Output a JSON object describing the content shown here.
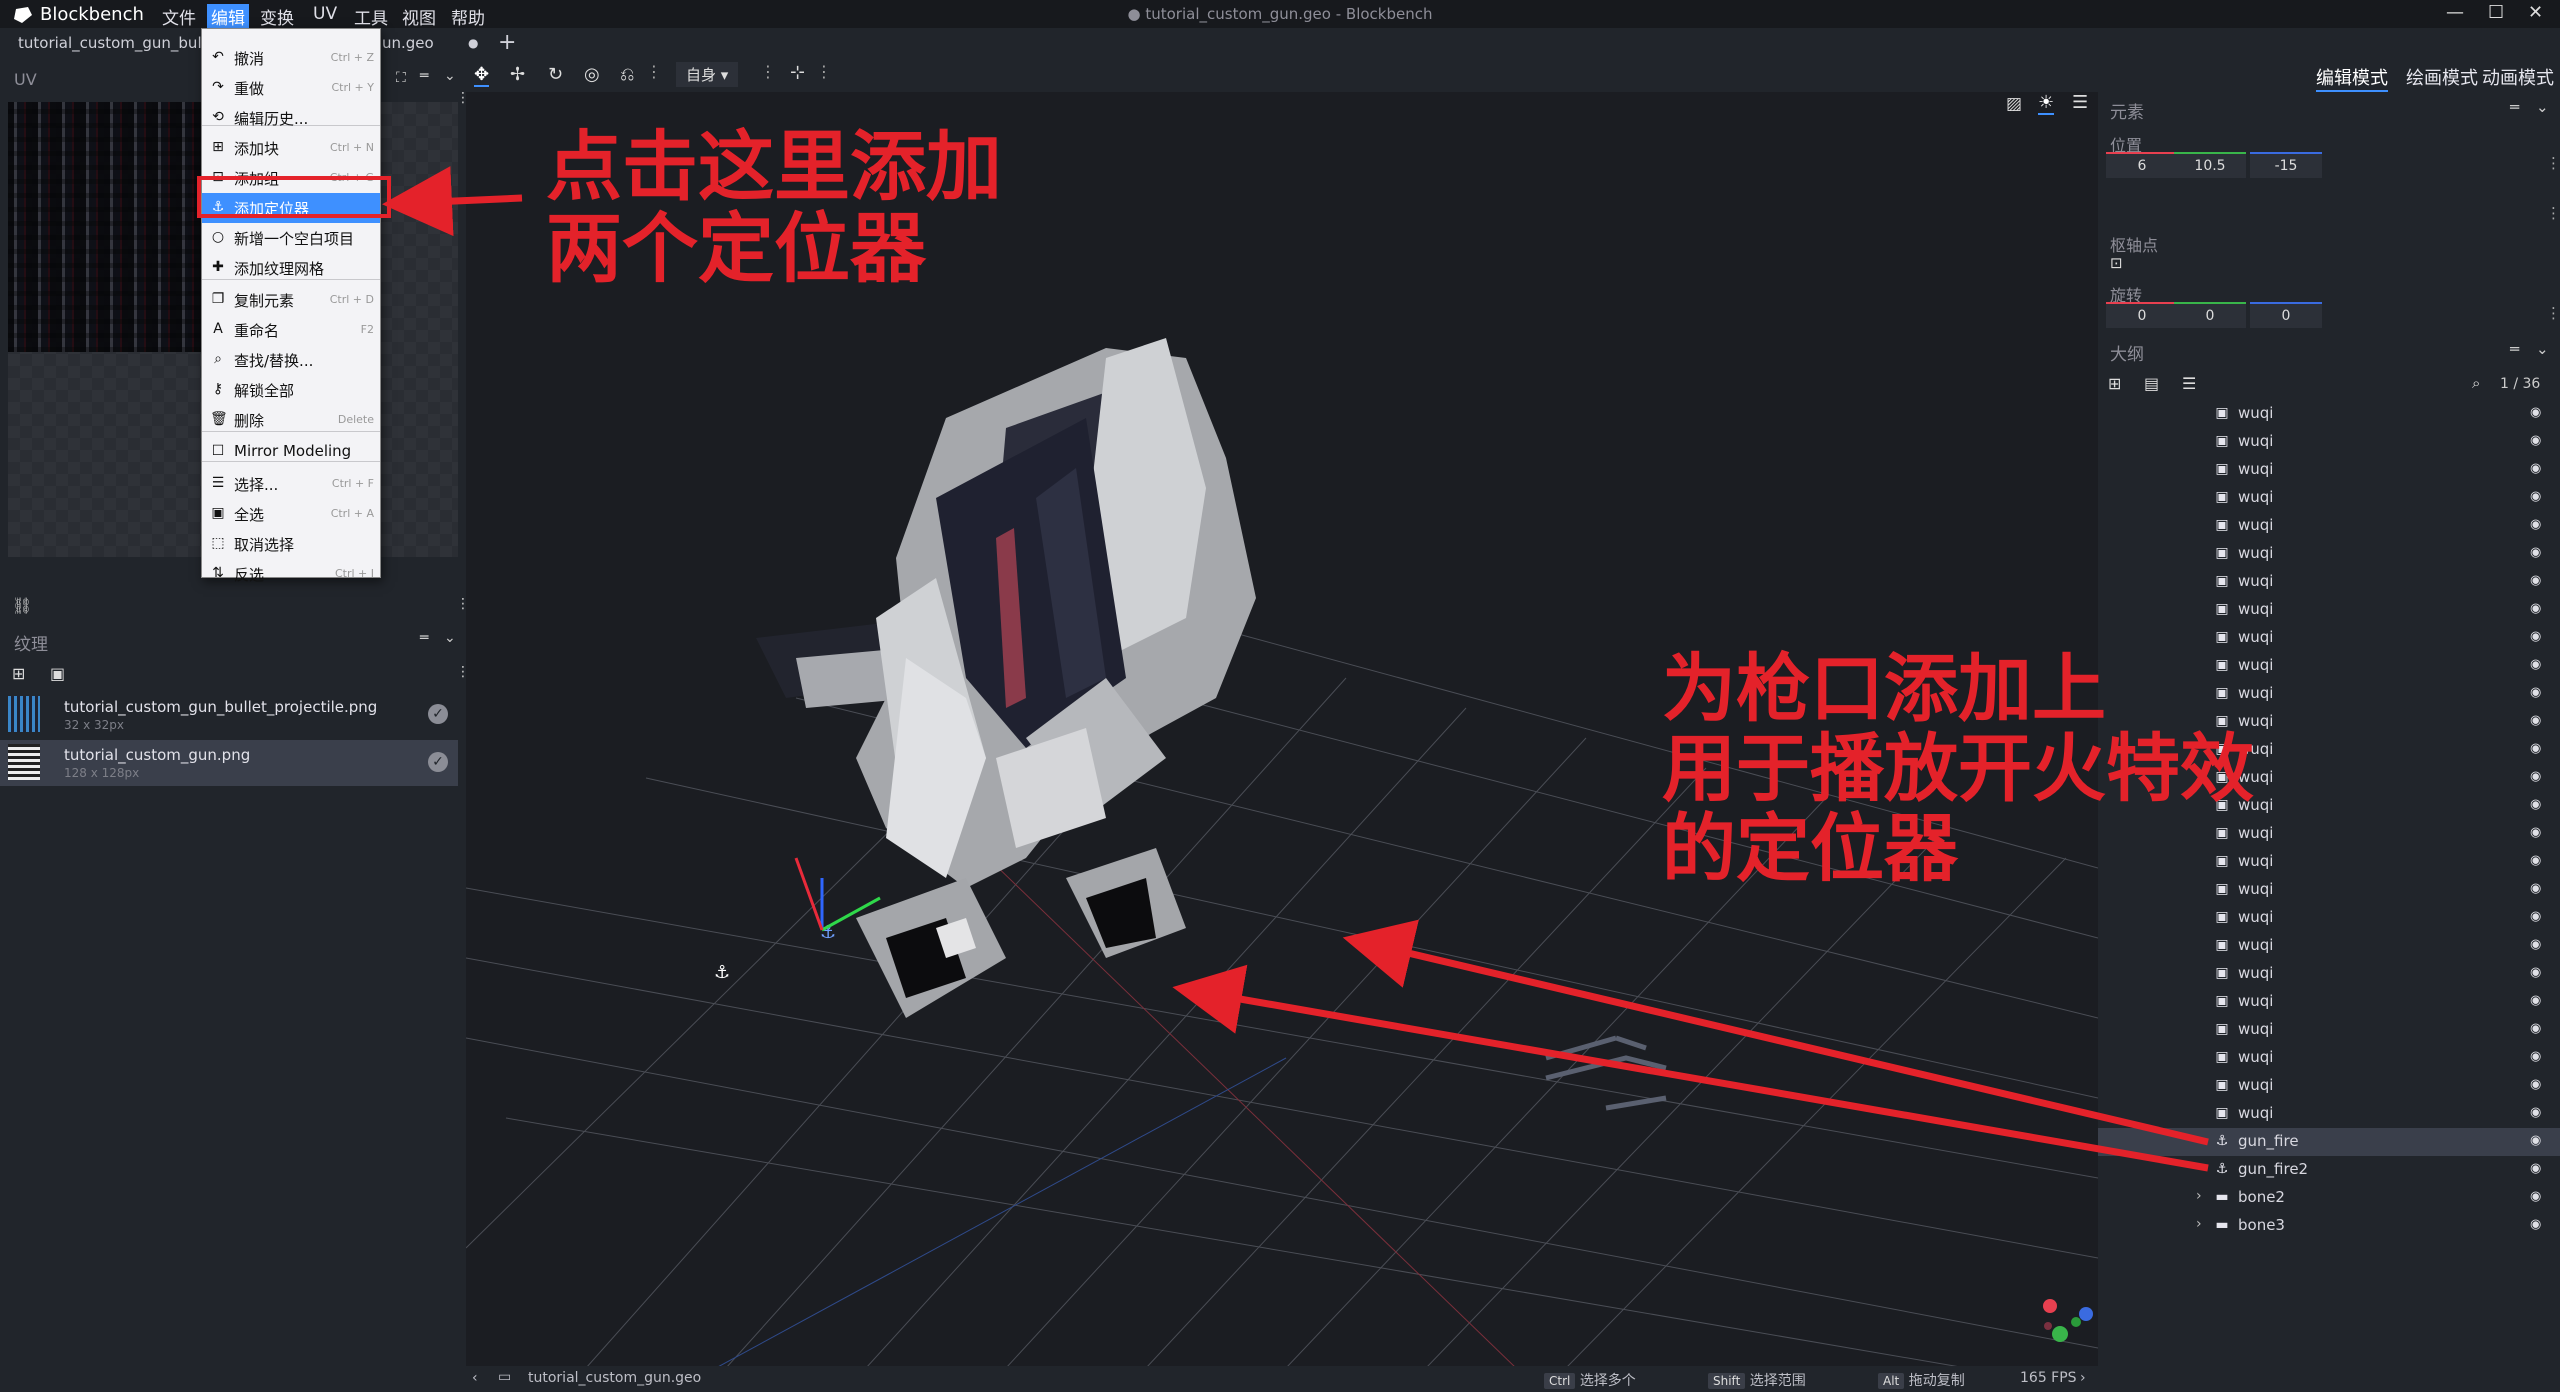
{
  "titlebar": {
    "app_name": "Blockbench",
    "window_title": "● tutorial_custom_gun.geo - Blockbench",
    "menus": [
      "文件",
      "编辑",
      "变换",
      "UV",
      "工具",
      "视图",
      "帮助"
    ]
  },
  "tabs": {
    "tab1": "tutorial_custom_gun_bullet",
    "tab2": "un.geo",
    "tab2_dot": "●",
    "add": "+"
  },
  "left_panel": {
    "uv_title": "UV",
    "textures_title": "纹理",
    "textures": [
      {
        "name": "tutorial_custom_gun_bullet_projectile.png",
        "size": "32 x 32px"
      },
      {
        "name": "tutorial_custom_gun.png",
        "size": "128 x 128px"
      }
    ]
  },
  "edit_menu": {
    "items": [
      {
        "label": "撤消",
        "shortcut": "Ctrl + Z",
        "icon": "undo-icon"
      },
      {
        "label": "重做",
        "shortcut": "Ctrl + Y",
        "icon": "redo-icon"
      },
      {
        "label": "编辑历史...",
        "shortcut": "",
        "icon": "history-icon"
      },
      {
        "label": "添加块",
        "shortcut": "Ctrl + N",
        "icon": "add-cube-icon"
      },
      {
        "label": "添加组",
        "shortcut": "Ctrl + G",
        "icon": "add-group-icon"
      },
      {
        "label": "添加定位器",
        "shortcut": "",
        "icon": "anchor-icon"
      },
      {
        "label": "新增一个空白项目",
        "shortcut": "",
        "icon": "null-object-icon"
      },
      {
        "label": "添加纹理网格",
        "shortcut": "",
        "icon": "puzzle-icon"
      },
      {
        "label": "复制元素",
        "shortcut": "Ctrl + D",
        "icon": "duplicate-icon"
      },
      {
        "label": "重命名",
        "shortcut": "F2",
        "icon": "rename-icon"
      },
      {
        "label": "查找/替换...",
        "shortcut": "",
        "icon": "find-replace-icon"
      },
      {
        "label": "解锁全部",
        "shortcut": "",
        "icon": "key-icon"
      },
      {
        "label": "删除",
        "shortcut": "Delete",
        "icon": "delete-icon"
      },
      {
        "label": "Mirror Modeling",
        "shortcut": "",
        "icon": "checkbox-icon"
      },
      {
        "label": "选择...",
        "shortcut": "Ctrl + F",
        "icon": "select-icon"
      },
      {
        "label": "全选",
        "shortcut": "Ctrl + A",
        "icon": "select-all-icon"
      },
      {
        "label": "取消选择",
        "shortcut": "",
        "icon": "deselect-icon"
      },
      {
        "label": "反选",
        "shortcut": "Ctrl + I",
        "icon": "invert-selection-icon"
      }
    ]
  },
  "viewport": {
    "space_select": "自身"
  },
  "right_panel": {
    "modes": [
      "编辑模式",
      "绘画模式",
      "动画模式"
    ],
    "element_title": "元素",
    "position_label": "位置",
    "position": [
      "6",
      "10.5",
      "-15"
    ],
    "pivot_label": "枢轴点",
    "rotation_label": "旋转",
    "rotation": [
      "0",
      "0",
      "0"
    ],
    "outliner_title": "大纲",
    "outliner_count": "1 / 36",
    "outliner": [
      {
        "label": "wuqi",
        "type": "cube"
      },
      {
        "label": "wuqi",
        "type": "cube"
      },
      {
        "label": "wuqi",
        "type": "cube"
      },
      {
        "label": "wuqi",
        "type": "cube"
      },
      {
        "label": "wuqi",
        "type": "cube"
      },
      {
        "label": "wuqi",
        "type": "cube"
      },
      {
        "label": "wuqi",
        "type": "cube"
      },
      {
        "label": "wuqi",
        "type": "cube"
      },
      {
        "label": "wuqi",
        "type": "cube"
      },
      {
        "label": "wuqi",
        "type": "cube"
      },
      {
        "label": "wuqi",
        "type": "cube"
      },
      {
        "label": "wuqi",
        "type": "cube"
      },
      {
        "label": "wuqi",
        "type": "cube"
      },
      {
        "label": "wuqi",
        "type": "cube"
      },
      {
        "label": "wuqi",
        "type": "cube"
      },
      {
        "label": "wuqi",
        "type": "cube"
      },
      {
        "label": "wuqi",
        "type": "cube"
      },
      {
        "label": "wuqi",
        "type": "cube"
      },
      {
        "label": "wuqi",
        "type": "cube"
      },
      {
        "label": "wuqi",
        "type": "cube"
      },
      {
        "label": "wuqi",
        "type": "cube"
      },
      {
        "label": "wuqi",
        "type": "cube"
      },
      {
        "label": "wuqi",
        "type": "cube"
      },
      {
        "label": "wuqi",
        "type": "cube"
      },
      {
        "label": "wuqi",
        "type": "cube"
      },
      {
        "label": "wuqi",
        "type": "cube"
      },
      {
        "label": "gun_fire",
        "type": "locator",
        "selected": true
      },
      {
        "label": "gun_fire2",
        "type": "locator"
      },
      {
        "label": "bone2",
        "type": "group"
      },
      {
        "label": "bone3",
        "type": "group"
      }
    ]
  },
  "statusbar": {
    "file": "tutorial_custom_gun.geo",
    "hint1_key": "Ctrl",
    "hint1": "选择多个",
    "hint2_key": "Shift",
    "hint2": "选择范围",
    "hint3_key": "Alt",
    "hint3": "拖动复制",
    "fps": "165 FPS"
  },
  "annotations": {
    "top": "点击这里添加\n两个定位器",
    "right": "为枪口添加上\n用于播放开火特效\n的定位器"
  },
  "colors": {
    "accent": "#3e90ff",
    "annotation_red": "#e4222a",
    "background": "#1e2127",
    "panel": "#21252b"
  }
}
